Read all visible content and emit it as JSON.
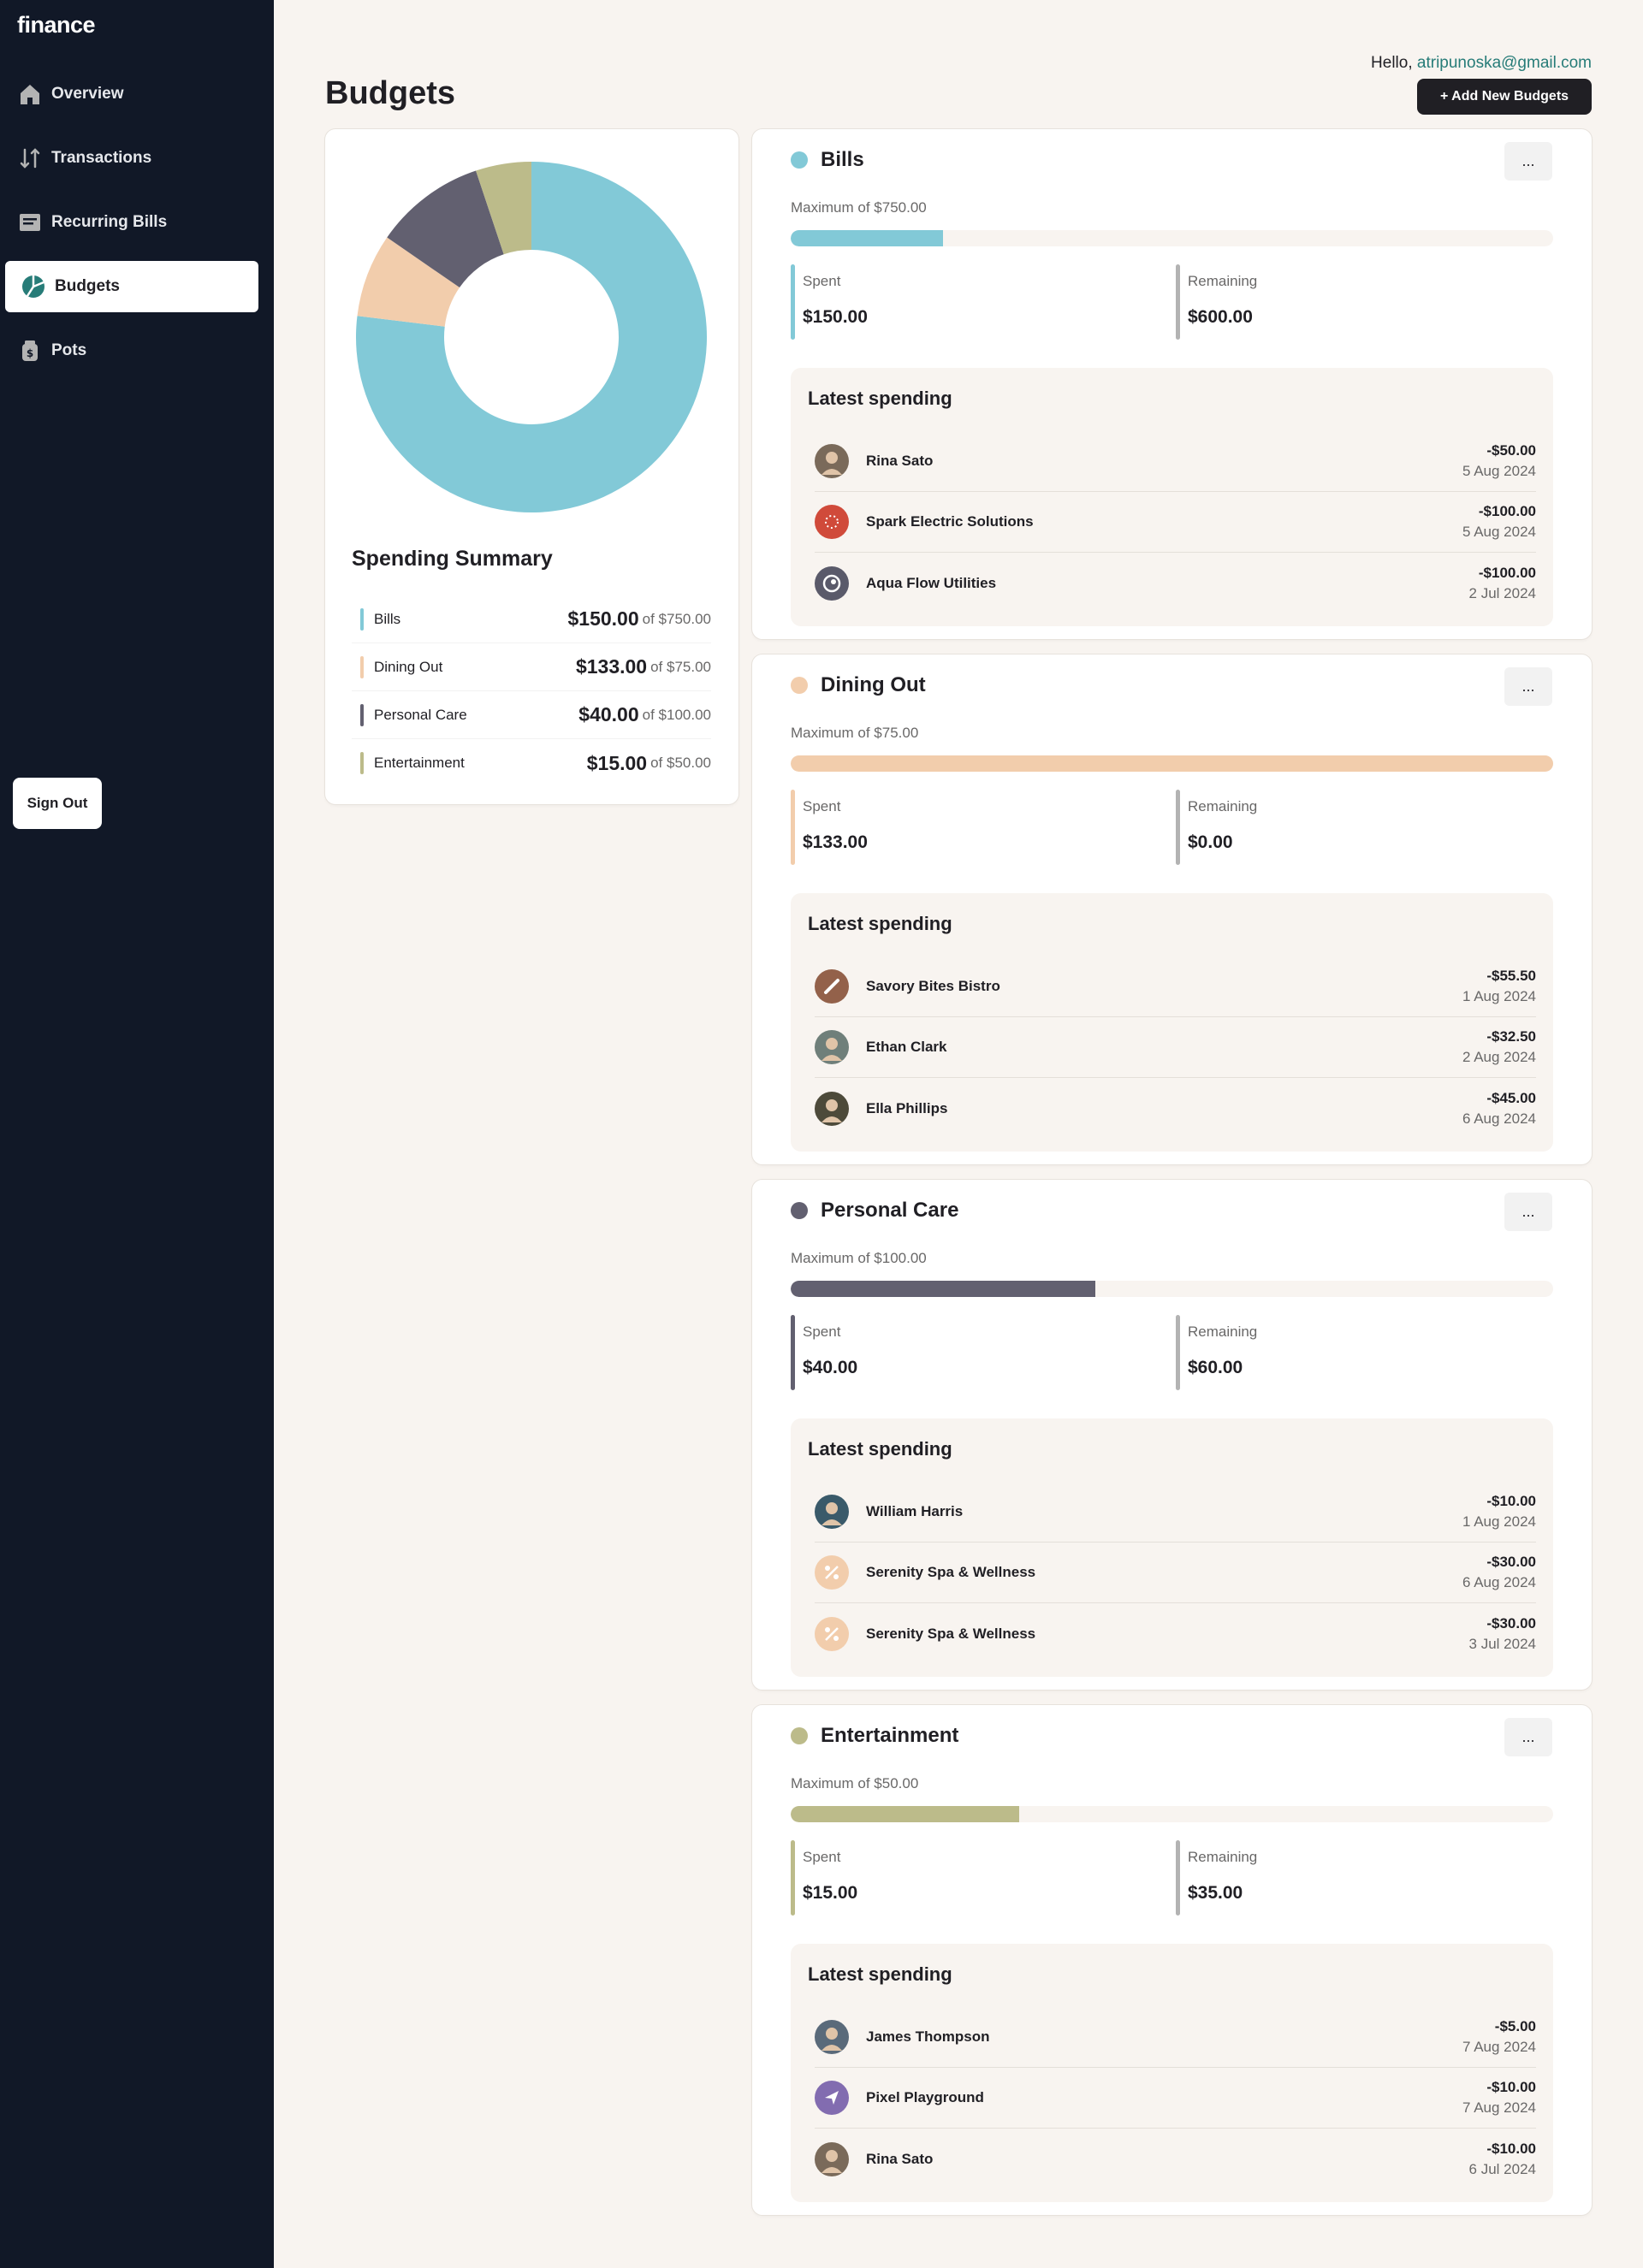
{
  "app": {
    "logo": "finance"
  },
  "sidebar": {
    "items": [
      {
        "label": "Overview",
        "icon": "home-icon"
      },
      {
        "label": "Transactions",
        "icon": "arrows-up-down-icon"
      },
      {
        "label": "Recurring Bills",
        "icon": "receipt-icon"
      },
      {
        "label": "Budgets",
        "icon": "pie-chart-icon",
        "active": true
      },
      {
        "label": "Pots",
        "icon": "jar-icon"
      }
    ],
    "signout_label": "Sign Out"
  },
  "header": {
    "title": "Budgets",
    "hello": "Hello,",
    "email": "atripunoska@gmail.com",
    "add_button": "+ Add New Budgets"
  },
  "summary": {
    "title": "Spending Summary",
    "rows": [
      {
        "name": "Bills",
        "amount": "$150.00",
        "of": "of $750.00",
        "color": "#82c9d7"
      },
      {
        "name": "Dining Out",
        "amount": "$133.00",
        "of": "of $75.00",
        "color": "#f2cdac"
      },
      {
        "name": "Personal Care",
        "amount": "$40.00",
        "of": "of $100.00",
        "color": "#626070"
      },
      {
        "name": "Entertainment",
        "amount": "$15.00",
        "of": "of $50.00",
        "color": "#bcbb8a"
      }
    ]
  },
  "chart_data": {
    "type": "pie",
    "categories": [
      "Bills",
      "Dining Out",
      "Personal Care",
      "Entertainment"
    ],
    "values": [
      750,
      75,
      100,
      50
    ],
    "colors": [
      "#82c9d7",
      "#f2cdac",
      "#626070",
      "#bcbb8a"
    ],
    "donut": true
  },
  "budgets": [
    {
      "name": "Bills",
      "color": "#82c9d7",
      "max": "Maximum of $750.00",
      "progress": 0.2,
      "spent_label": "Spent",
      "spent": "$150.00",
      "remaining_label": "Remaining",
      "remaining": "$600.00",
      "latest_title": "Latest spending",
      "menu": "...",
      "transactions": [
        {
          "name": "Rina Sato",
          "amount": "-$50.00",
          "date": "5 Aug 2024",
          "avatar": "person",
          "avatar_color": "#7a6a5a"
        },
        {
          "name": "Spark Electric Solutions",
          "amount": "-$100.00",
          "date": "5 Aug 2024",
          "avatar": "spark",
          "avatar_color": "#d04a3a"
        },
        {
          "name": "Aqua Flow Utilities",
          "amount": "-$100.00",
          "date": "2 Jul 2024",
          "avatar": "aqua",
          "avatar_color": "#5a5a6a"
        }
      ]
    },
    {
      "name": "Dining Out",
      "color": "#f2cdac",
      "max": "Maximum of $75.00",
      "progress": 1.0,
      "spent_label": "Spent",
      "spent": "$133.00",
      "remaining_label": "Remaining",
      "remaining": "$0.00",
      "latest_title": "Latest spending",
      "menu": "...",
      "transactions": [
        {
          "name": "Savory Bites Bistro",
          "amount": "-$55.50",
          "date": "1 Aug 2024",
          "avatar": "bistro",
          "avatar_color": "#93614a"
        },
        {
          "name": "Ethan Clark",
          "amount": "-$32.50",
          "date": "2 Aug 2024",
          "avatar": "person",
          "avatar_color": "#6f7f7a"
        },
        {
          "name": "Ella Phillips",
          "amount": "-$45.00",
          "date": "6 Aug 2024",
          "avatar": "person",
          "avatar_color": "#4d4a3a"
        }
      ]
    },
    {
      "name": "Personal Care",
      "color": "#626070",
      "max": "Maximum of $100.00",
      "progress": 0.4,
      "spent_label": "Spent",
      "spent": "$40.00",
      "remaining_label": "Remaining",
      "remaining": "$60.00",
      "latest_title": "Latest spending",
      "menu": "...",
      "transactions": [
        {
          "name": "William Harris",
          "amount": "-$10.00",
          "date": "1 Aug 2024",
          "avatar": "person",
          "avatar_color": "#3a5a6a"
        },
        {
          "name": "Serenity Spa & Wellness",
          "amount": "-$30.00",
          "date": "6 Aug 2024",
          "avatar": "spa",
          "avatar_color": "#f2cdac"
        },
        {
          "name": "Serenity Spa & Wellness",
          "amount": "-$30.00",
          "date": "3 Jul 2024",
          "avatar": "spa",
          "avatar_color": "#f2cdac"
        }
      ]
    },
    {
      "name": "Entertainment",
      "color": "#bcbb8a",
      "max": "Maximum of $50.00",
      "progress": 0.3,
      "spent_label": "Spent",
      "spent": "$15.00",
      "remaining_label": "Remaining",
      "remaining": "$35.00",
      "latest_title": "Latest spending",
      "menu": "...",
      "transactions": [
        {
          "name": "James Thompson",
          "amount": "-$5.00",
          "date": "7 Aug 2024",
          "avatar": "person",
          "avatar_color": "#5a6a7a"
        },
        {
          "name": "Pixel Playground",
          "amount": "-$10.00",
          "date": "7 Aug 2024",
          "avatar": "pixel",
          "avatar_color": "#826cb0"
        },
        {
          "name": "Rina Sato",
          "amount": "-$10.00",
          "date": "6 Jul 2024",
          "avatar": "person",
          "avatar_color": "#7a6a5a"
        }
      ]
    }
  ],
  "colors": {
    "sidebar_bg": "#111827",
    "page_bg": "#f8f4f0",
    "accent": "#277c78",
    "dark": "#201f24"
  }
}
